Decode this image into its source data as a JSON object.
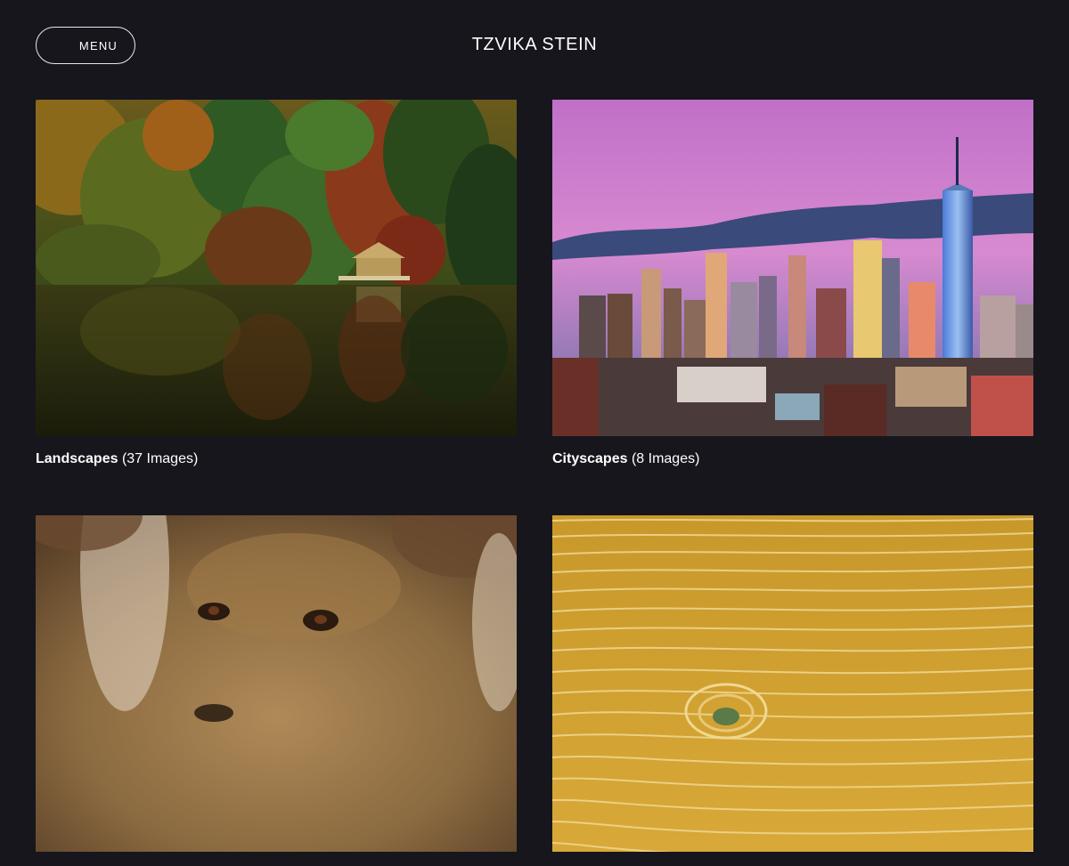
{
  "header": {
    "menu_label": "MENU",
    "site_title": "TZVIKA STEIN"
  },
  "gallery": {
    "items": [
      {
        "name": "Landscapes",
        "count": "(37 Images)"
      },
      {
        "name": "Cityscapes",
        "count": "(8 Images)"
      },
      {
        "name": "",
        "count": ""
      },
      {
        "name": "",
        "count": ""
      }
    ]
  },
  "colors": {
    "background": "#17161d",
    "text": "#ffffff",
    "button_border": "#e8e8ec"
  }
}
